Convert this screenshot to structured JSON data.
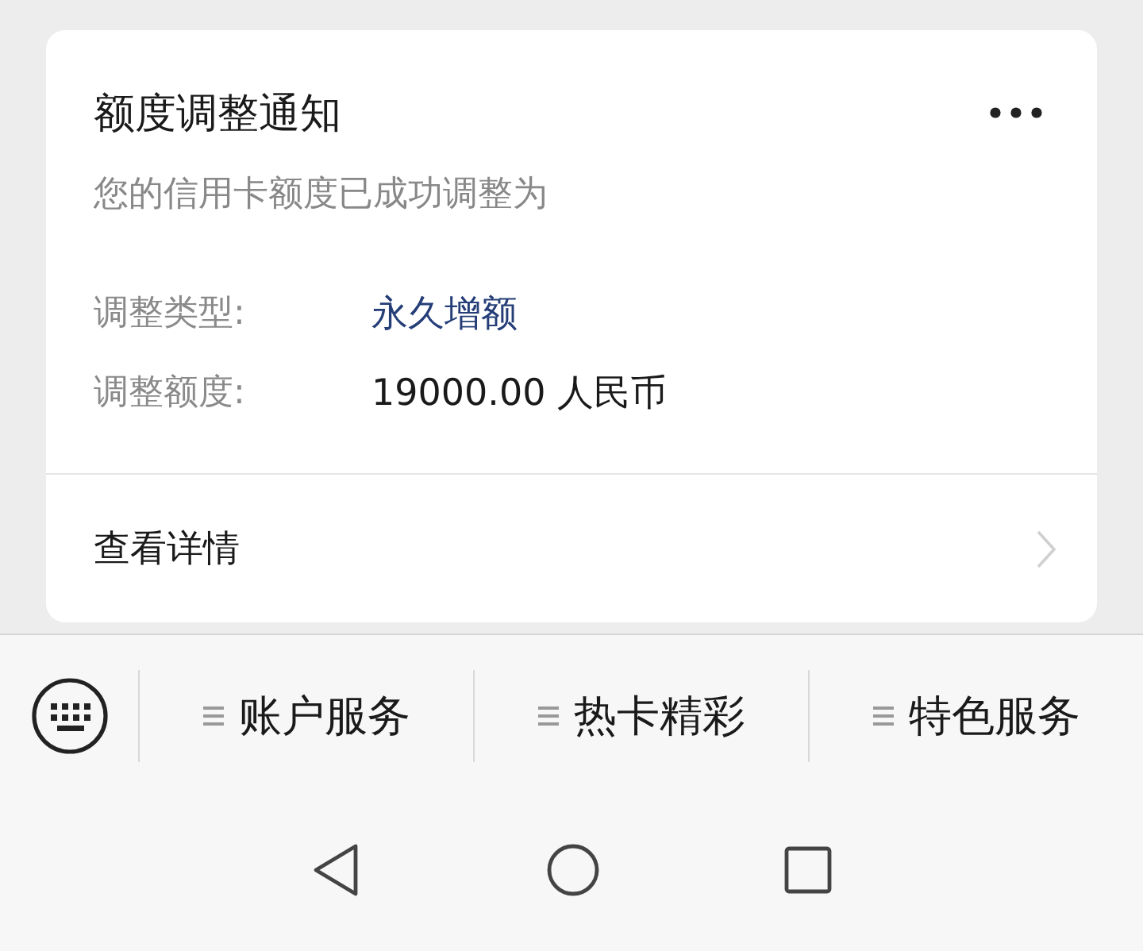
{
  "card": {
    "title": "额度调整通知",
    "subtitle": "您的信用卡额度已成功调整为",
    "fields": [
      {
        "label": "调整类型:",
        "value": "永久增额",
        "kind": "link"
      },
      {
        "label": "调整额度:",
        "value": "19000.00 人民币",
        "kind": "plain"
      }
    ],
    "detail_link": "查看详情"
  },
  "menu": [
    {
      "label": "账户服务"
    },
    {
      "label": "热卡精彩"
    },
    {
      "label": "特色服务"
    }
  ]
}
